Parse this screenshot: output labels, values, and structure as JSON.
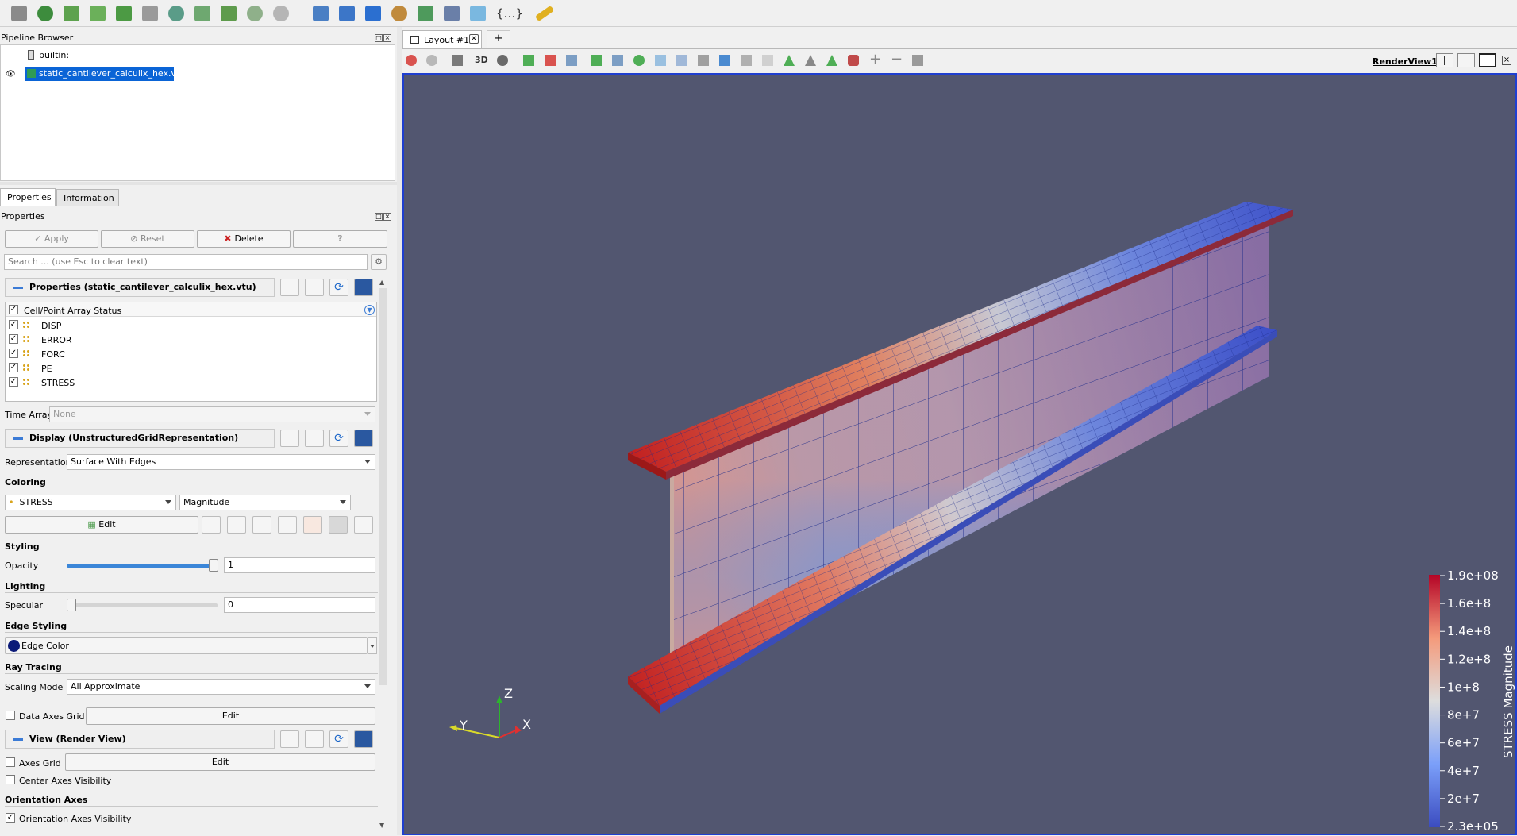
{
  "pipeline": {
    "title": "Pipeline Browser",
    "builtin": "builtin:",
    "file": "static_cantilever_calculix_hex.vtu"
  },
  "tabs": {
    "properties": "Properties",
    "information": "Information"
  },
  "props": {
    "title": "Properties",
    "apply": "Apply",
    "reset": "Reset",
    "delete": "Delete",
    "help": "?",
    "search_placeholder": "Search ... (use Esc to clear text)",
    "section_properties": "Properties (static_cantilever_calculix_hex.vtu)",
    "array_status_header": "Cell/Point Array Status",
    "arrays": [
      "DISP",
      "ERROR",
      "FORC",
      "PE",
      "STRESS"
    ],
    "time_array_label": "Time Array",
    "time_array_value": "None",
    "section_display": "Display (UnstructuredGridRepresentation)",
    "representation_label": "Representation",
    "representation_value": "Surface With Edges",
    "coloring_label": "Coloring",
    "coloring_array": "STRESS",
    "coloring_component": "Magnitude",
    "edit": "Edit",
    "styling_label": "Styling",
    "opacity_label": "Opacity",
    "opacity_value": "1",
    "lighting_label": "Lighting",
    "specular_label": "Specular",
    "specular_value": "0",
    "edge_styling_label": "Edge Styling",
    "edge_color_label": "Edge Color",
    "ray_tracing_label": "Ray Tracing",
    "scaling_mode_label": "Scaling Mode",
    "scaling_mode_value": "All Approximate",
    "data_axes_grid": "Data Axes Grid",
    "section_view": "View (Render View)",
    "axes_grid": "Axes Grid",
    "center_axes": "Center Axes Visibility",
    "orientation_axes_label": "Orientation Axes",
    "orientation_axes_visibility": "Orientation Axes Visibility"
  },
  "layout": {
    "tab": "Layout #1",
    "add": "+",
    "three_d": "3D",
    "render_view": "RenderView1"
  },
  "colorbar": {
    "title": "STRESS Magnitude",
    "ticks": [
      "1.9e+08",
      "1.6e+8",
      "1.4e+8",
      "1.2e+8",
      "1e+8",
      "8e+7",
      "6e+7",
      "4e+7",
      "2e+7",
      "2.3e+05"
    ]
  },
  "axes": {
    "x": "X",
    "y": "Y",
    "z": "Z"
  },
  "colors": {
    "selection": "#0a64d6",
    "viewport_bg": "#525670",
    "active_border": "#1f3fd0",
    "delete_red": "#cc2222",
    "edge_color": "#0b1a78"
  }
}
